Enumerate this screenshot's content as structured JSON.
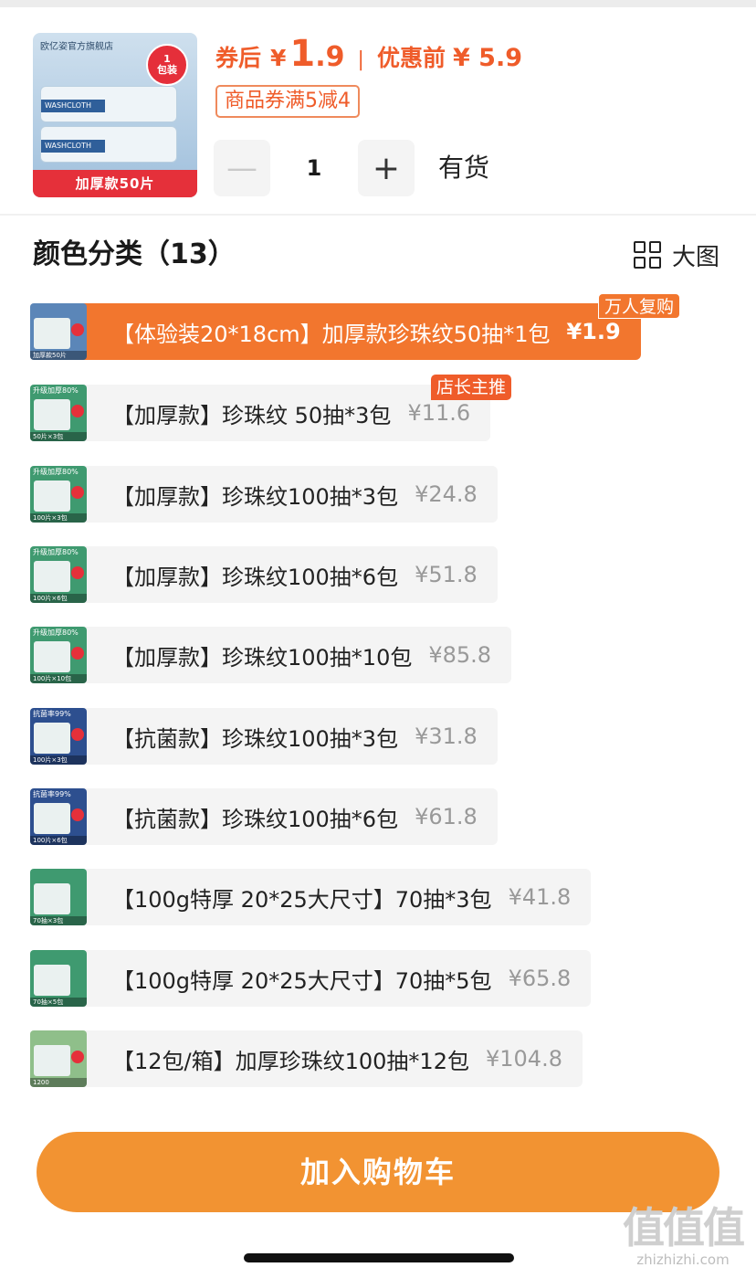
{
  "product": {
    "thumb_brand": "欧亿姿官方旗舰店",
    "thumb_badge_top": "1",
    "thumb_badge_bottom": "包装",
    "thumb_pack_text": "WASHCLOTH",
    "thumb_banner": "加厚款50片",
    "price_after_label": "券后",
    "price_after_currency": "¥",
    "price_after_int": "1",
    "price_after_dec": ".9",
    "price_separator": "|",
    "price_before_label": "优惠前",
    "price_before": "¥ 5.9",
    "coupon": "商品券满5减4",
    "quantity": "1",
    "minus_symbol": "—",
    "plus_symbol": "+",
    "stock_status": "有货"
  },
  "section": {
    "title": "颜色分类（13）",
    "view_toggle_label": "大图"
  },
  "tags": {
    "repurchase": "万人复购",
    "recommend": "店长主推"
  },
  "variants": [
    {
      "name": "【体验装20*18cm】加厚款珍珠纹50抽*1包",
      "price": "¥1.9",
      "selected": true,
      "thumb_band": "",
      "thumb_foot": "加厚款50片",
      "thumb_color": "#5b86b8"
    },
    {
      "name": "【加厚款】珍珠纹 50抽*3包",
      "price": "¥11.6",
      "selected": false,
      "thumb_band": "升级加厚80%",
      "thumb_foot": "50片×3包",
      "thumb_color": "#3f9a70"
    },
    {
      "name": "【加厚款】珍珠纹100抽*3包",
      "price": "¥24.8",
      "selected": false,
      "thumb_band": "升级加厚80%",
      "thumb_foot": "100片×3包",
      "thumb_color": "#3f9a70"
    },
    {
      "name": "【加厚款】珍珠纹100抽*6包",
      "price": "¥51.8",
      "selected": false,
      "thumb_band": "升级加厚80%",
      "thumb_foot": "100片×6包",
      "thumb_color": "#3f9a70"
    },
    {
      "name": "【加厚款】珍珠纹100抽*10包",
      "price": "¥85.8",
      "selected": false,
      "thumb_band": "升级加厚80%",
      "thumb_foot": "100片×10包",
      "thumb_color": "#3f9a70"
    },
    {
      "name": "【抗菌款】珍珠纹100抽*3包",
      "price": "¥31.8",
      "selected": false,
      "thumb_band": "抗菌率99%",
      "thumb_foot": "100片×3包",
      "thumb_color": "#2d4f8f"
    },
    {
      "name": "【抗菌款】珍珠纹100抽*6包",
      "price": "¥61.8",
      "selected": false,
      "thumb_band": "抗菌率99%",
      "thumb_foot": "100片×6包",
      "thumb_color": "#2d4f8f"
    },
    {
      "name": "【100g特厚 20*25大尺寸】70抽*3包",
      "price": "¥41.8",
      "selected": false,
      "thumb_band": "",
      "thumb_foot": "70抽×3包",
      "thumb_color": "#3f9a70"
    },
    {
      "name": "【100g特厚 20*25大尺寸】70抽*5包",
      "price": "¥65.8",
      "selected": false,
      "thumb_band": "",
      "thumb_foot": "70抽×5包",
      "thumb_color": "#3f9a70"
    },
    {
      "name": "【12包/箱】加厚珍珠纹100抽*12包",
      "price": "¥104.8",
      "selected": false,
      "thumb_band": "",
      "thumb_foot": "1200",
      "thumb_color": "#8fbf8a"
    }
  ],
  "actions": {
    "add_to_cart": "加入购物车"
  },
  "watermark": {
    "logo": "值值值",
    "url": "zhizhizhi.com"
  }
}
